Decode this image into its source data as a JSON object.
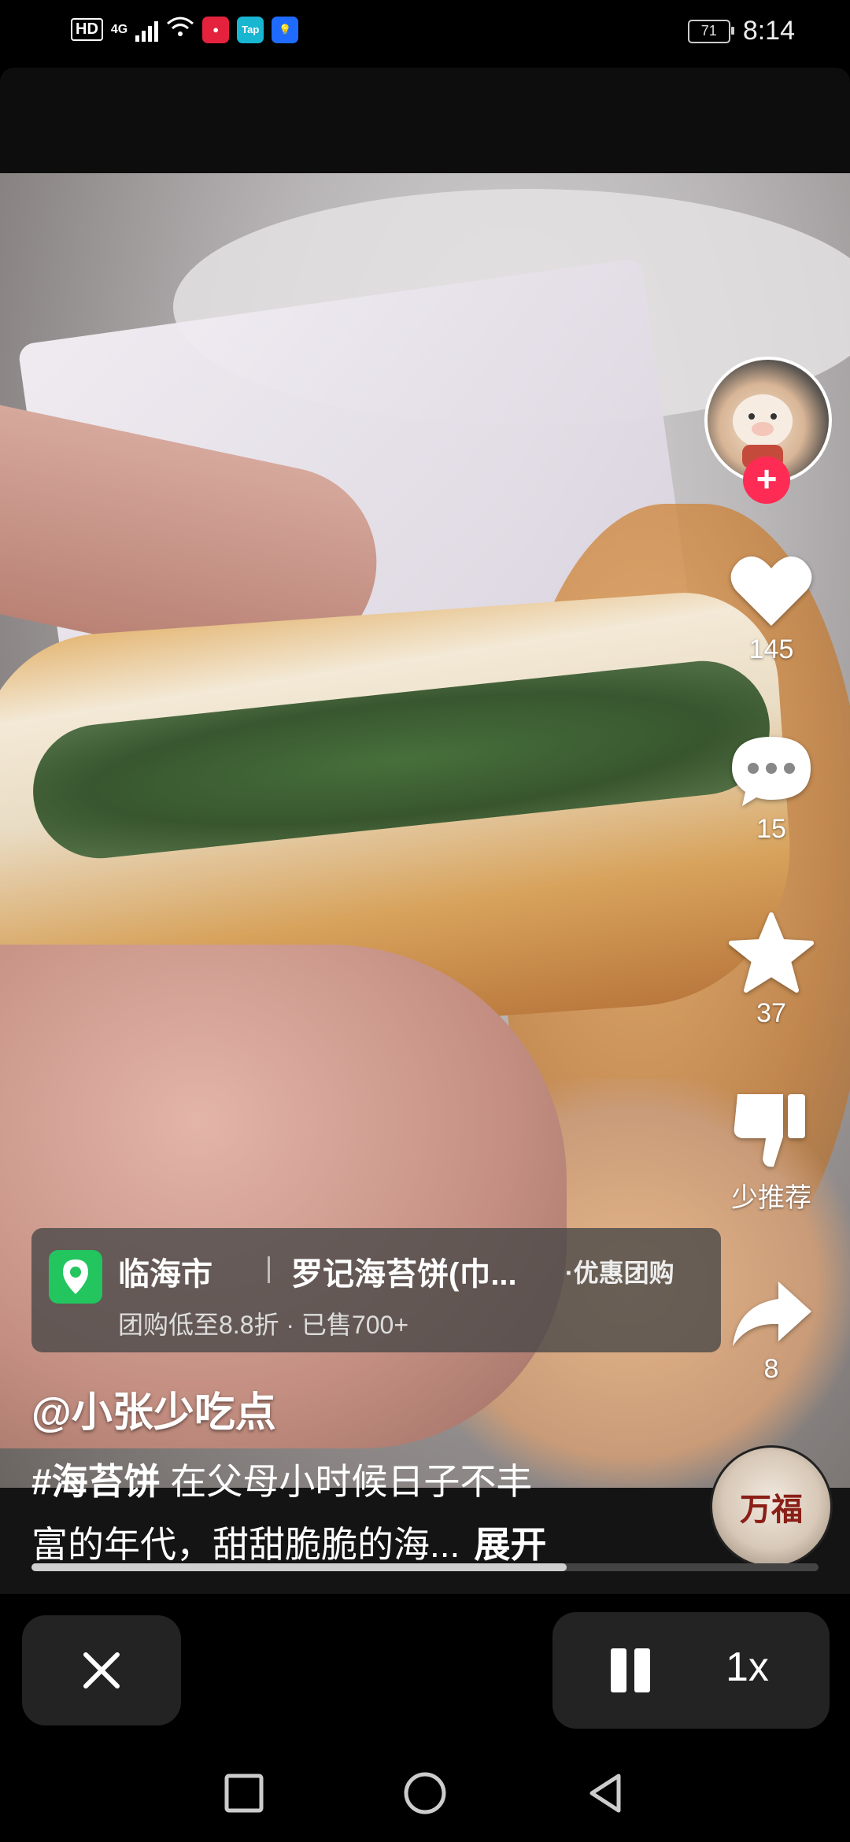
{
  "status_bar": {
    "hd": "HD",
    "network": "4G",
    "app_icon_tap": "Tap",
    "battery": "71",
    "time": "8:14"
  },
  "actions": {
    "likes": "145",
    "comments": "15",
    "favorites": "37",
    "dislike_label": "少推荐",
    "shares": "8"
  },
  "location": {
    "city": "临海市",
    "shop": "罗记海苔饼(巾...",
    "tag": "·优惠团购",
    "sub": "团购低至8.8折 · 已售700+"
  },
  "post": {
    "author": "@小张少吃点",
    "hashtag": "#海苔饼",
    "text_line1": " 在父母小时候日子不丰",
    "text_line2": "富的年代，甜甜脆脆的海...",
    "expand": "展开"
  },
  "music_disc_text": "万福",
  "player": {
    "progress": 0.68,
    "speed": "1x"
  },
  "colors": {
    "follow": "#fe2c55",
    "location_pin": "#22c55e"
  }
}
